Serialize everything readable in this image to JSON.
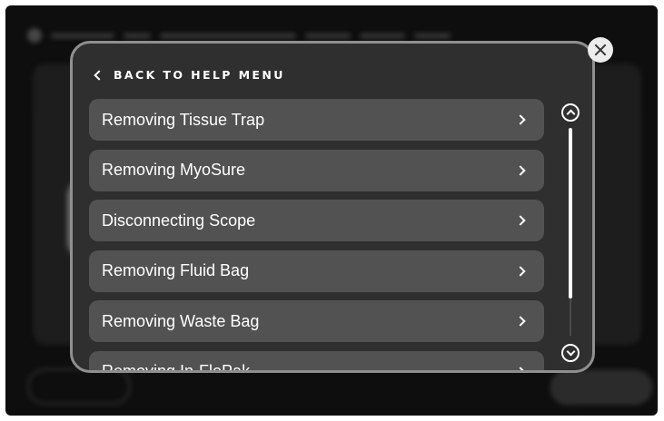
{
  "modal": {
    "back_label": "BACK TO HELP MENU",
    "items": [
      {
        "label": "Removing Tissue Trap"
      },
      {
        "label": "Removing MyoSure"
      },
      {
        "label": "Disconnecting Scope"
      },
      {
        "label": "Removing Fluid Bag"
      },
      {
        "label": "Removing Waste Bag"
      },
      {
        "label": "Removing In-FloPak"
      }
    ]
  },
  "icons": {
    "back": "chevron-left-icon",
    "item_arrow": "chevron-right-icon",
    "scroll_up": "chevron-up-circle-icon",
    "scroll_down": "chevron-down-circle-icon",
    "close": "close-icon"
  },
  "colors": {
    "background": "#0e0e0e",
    "modal": "#2f2f2f",
    "modal_border": "#8f8f8f",
    "item": "#525252",
    "text": "#ffffff"
  }
}
